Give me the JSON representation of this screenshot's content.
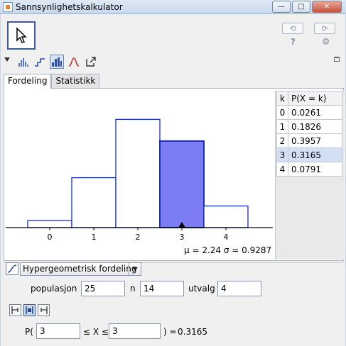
{
  "window": {
    "title": "Sannsynlighetskalkulator",
    "minimize": "—",
    "maximize": "□",
    "close": "✕"
  },
  "toolbar": {
    "undo": "⟲",
    "redo": "⟳",
    "help": "?",
    "settings": "⚙"
  },
  "tabs": [
    {
      "label": "Fordeling",
      "active": true
    },
    {
      "label": "Statistikk",
      "active": false
    }
  ],
  "chart_data": {
    "type": "bar",
    "categories": [
      "0",
      "1",
      "2",
      "3",
      "4"
    ],
    "values": [
      0.0261,
      0.1826,
      0.3957,
      0.3165,
      0.0791
    ],
    "highlighted": [
      "3"
    ],
    "ylim": [
      0,
      0.42
    ],
    "colors": {
      "bar_fill": "#ffffff",
      "bar_stroke": "#1a2fb5",
      "highlight_fill": "#7c7cf4"
    },
    "summary": "μ = 2.24   σ = 0.9287"
  },
  "table": {
    "headers": [
      "k",
      "P(X = k)"
    ],
    "rows": [
      [
        "0",
        "0.0261"
      ],
      [
        "1",
        "0.1826"
      ],
      [
        "2",
        "0.3957"
      ],
      [
        "3",
        "0.3165"
      ],
      [
        "4",
        "0.0791"
      ]
    ],
    "selected_row": 3
  },
  "distribution": {
    "selected": "Hypergeometrisk fordeling"
  },
  "parameters": {
    "population_label": "populasjon",
    "population": "25",
    "n_label": "n",
    "n": "14",
    "sample_label": "utvalg",
    "sample": "4"
  },
  "probability": {
    "prefix": "P(",
    "lower": "3",
    "middle": "≤ X ≤",
    "upper": "3",
    "suffix": ") =",
    "result": "0.3165"
  }
}
